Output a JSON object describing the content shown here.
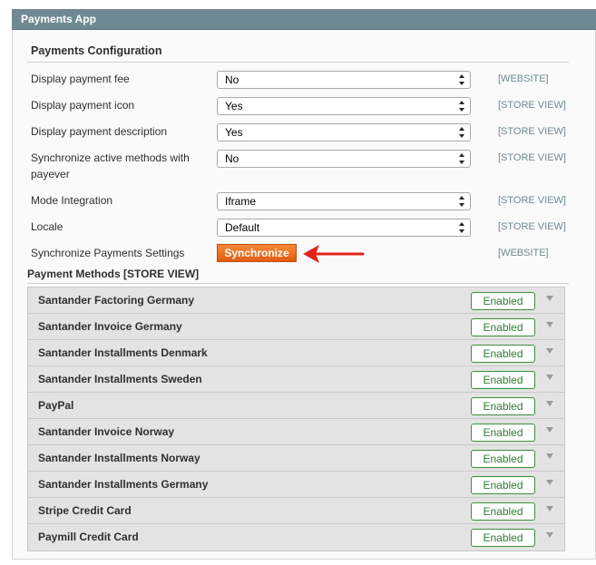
{
  "section": {
    "title": "Payments App"
  },
  "config": {
    "title": "Payments Configuration",
    "rows": [
      {
        "label": "Display payment fee",
        "value": "No",
        "scope": "[WEBSITE]"
      },
      {
        "label": "Display payment icon",
        "value": "Yes",
        "scope": "[STORE VIEW]"
      },
      {
        "label": "Display payment description",
        "value": "Yes",
        "scope": "[STORE VIEW]"
      },
      {
        "label": "Synchronize active methods with payever",
        "value": "No",
        "scope": "[STORE VIEW]"
      },
      {
        "label": "Mode Integration",
        "value": "Iframe",
        "scope": "[STORE VIEW]"
      },
      {
        "label": "Locale",
        "value": "Default",
        "scope": "[STORE VIEW]"
      }
    ],
    "sync": {
      "label": "Synchronize Payments Settings",
      "button": "Synchronize",
      "scope": "[WEBSITE]"
    }
  },
  "methods": {
    "title": "Payment Methods [STORE VIEW]",
    "items": [
      {
        "name": "Santander Factoring Germany",
        "status": "Enabled"
      },
      {
        "name": "Santander Invoice Germany",
        "status": "Enabled"
      },
      {
        "name": "Santander Installments Denmark",
        "status": "Enabled"
      },
      {
        "name": "Santander Installments Sweden",
        "status": "Enabled"
      },
      {
        "name": "PayPal",
        "status": "Enabled"
      },
      {
        "name": "Santander Invoice Norway",
        "status": "Enabled"
      },
      {
        "name": "Santander Installments Norway",
        "status": "Enabled"
      },
      {
        "name": "Santander Installments Germany",
        "status": "Enabled"
      },
      {
        "name": "Stripe Credit Card",
        "status": "Enabled"
      },
      {
        "name": "Paymill Credit Card",
        "status": "Enabled"
      }
    ]
  },
  "colors": {
    "header": "#6f8992",
    "accent_button": "#e8661a",
    "annotation_arrow": "#e2231a",
    "enabled": "#2e7d32"
  }
}
